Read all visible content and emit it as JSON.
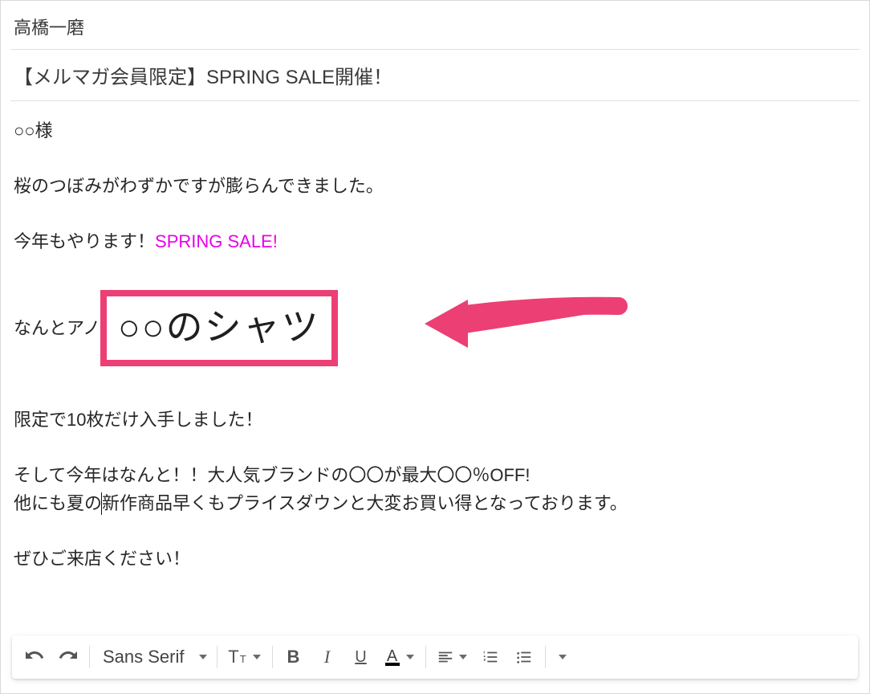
{
  "header": {
    "recipient": "高橋一磨"
  },
  "subject": {
    "text": "【メルマガ会員限定】SPRING SALE開催！"
  },
  "body": {
    "greeting": "○○様",
    "line1": "桜のつぼみがわずかですが膨らんできました。",
    "line2a": "今年もやります！",
    "line2b": "SPRING SALE!",
    "highlight_prefix": "なんとアノ",
    "highlight_text": "○○のシャツ",
    "line3": "限定で10枚だけ入手しました！",
    "line4": "そして今年はなんと！！大人気ブランドの〇〇が最大〇〇％OFF!",
    "line5": "他にも夏の新作商品早くもプライスダウンと大変お買い得となっております。",
    "line6": "ぜひご来店ください！"
  },
  "toolbar": {
    "font": "Sans Serif"
  },
  "colors": {
    "magenta": "#e800e8",
    "highlight_border": "#ec3f74",
    "arrow": "#ec3f74"
  }
}
